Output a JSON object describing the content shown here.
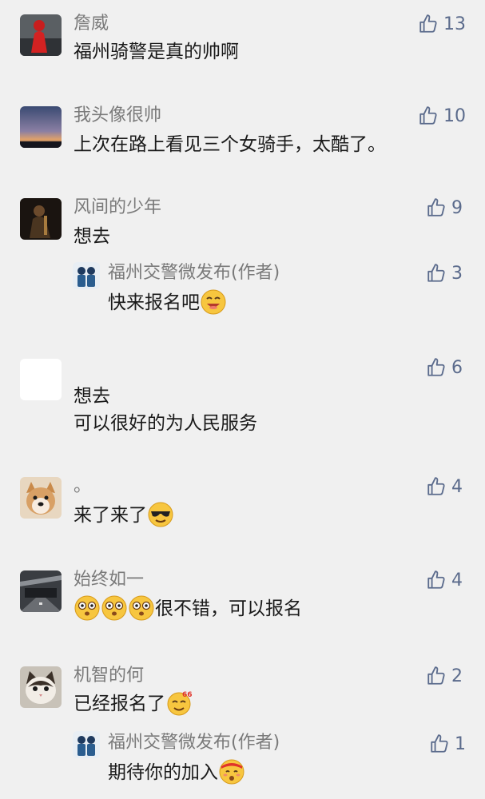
{
  "comments": [
    {
      "name": "詹威",
      "text": "福州骑警是真的帅啊",
      "likes": "13",
      "avatar_icon": "red-figure-avatar"
    },
    {
      "name": "我头像很帅",
      "text": "上次在路上看见三个女骑手，太酷了。",
      "likes": "10",
      "avatar_icon": "sunset-sky-avatar"
    },
    {
      "name": "风间的少年",
      "text": "想去",
      "likes": "9",
      "avatar_icon": "dark-figure-avatar",
      "reply": {
        "name": "福州交警微发布(作者)",
        "text": "快来报名吧",
        "likes": "3",
        "emoji": "smiling-emoji"
      }
    },
    {
      "name": "",
      "text": "想去",
      "text2": "可以很好的为人民服务",
      "likes": "6",
      "avatar_icon": "blank-avatar"
    },
    {
      "name": "。",
      "text": "来了来了",
      "likes": "4",
      "avatar_icon": "shiba-dog-avatar",
      "emoji": "cool-sunglasses-emoji"
    },
    {
      "name": "始终如一",
      "text": "很不错，可以报名",
      "likes": "4",
      "avatar_icon": "tunnel-road-avatar",
      "emoji": "surprised-emoji"
    },
    {
      "name": "机智的何",
      "text": "已经报名了",
      "likes": "2",
      "avatar_icon": "cat-avatar",
      "emoji": "666-emoji",
      "reply": {
        "name": "福州交警微发布(作者)",
        "text": "期待你的加入",
        "likes": "1",
        "emoji": "shy-smile-emoji"
      }
    }
  ],
  "colors": {
    "background": "#f0f0f0",
    "name": "#7a7a7a",
    "text": "#1a1a1a",
    "like": "#5b6b8c"
  }
}
